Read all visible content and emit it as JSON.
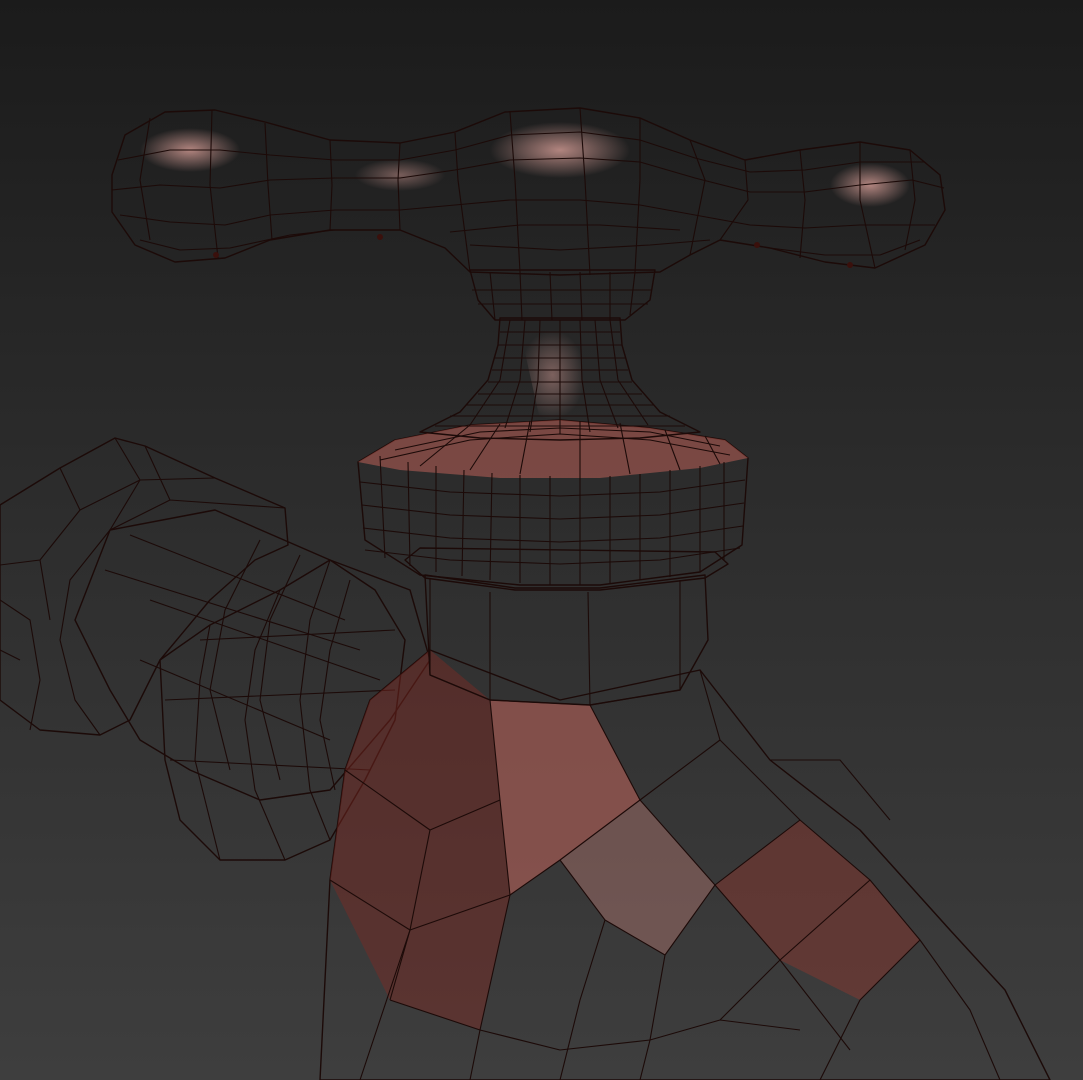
{
  "scene": {
    "subject": "faucet-3d-model",
    "display_mode": "wireframe-on-shaded",
    "colors": {
      "background_top": "#1b1b1b",
      "background_bottom": "#3e3e3e",
      "material": "#b84a3e",
      "material_highlight": "#d8847a",
      "material_shadow": "#5e1d17",
      "wire": "#1c0a08"
    }
  }
}
